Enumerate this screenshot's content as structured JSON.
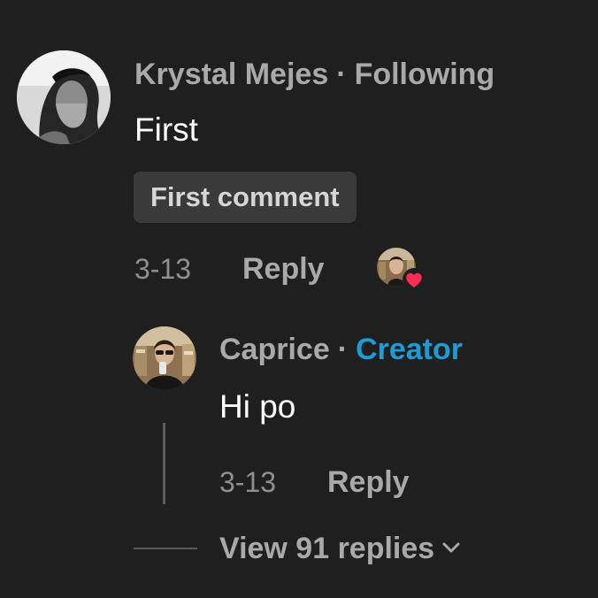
{
  "comment": {
    "author": "Krystal Mejes",
    "separator": "·",
    "relationship": "Following",
    "text": "First",
    "badge": "First comment",
    "date": "3-13",
    "reply_label": "Reply",
    "liked_by_creator": true
  },
  "reply": {
    "author": "Caprice",
    "separator": "·",
    "role": "Creator",
    "text": "Hi po",
    "date": "3-13",
    "reply_label": "Reply"
  },
  "view_replies": {
    "label": "View 91 replies"
  },
  "colors": {
    "background": "#1f1f1f",
    "muted_text": "#a9a9a9",
    "creator_accent": "#1e9bd6",
    "heart": "#fe2c55",
    "pill_bg": "#3a3a3a"
  },
  "icons": {
    "liked": "heart-icon",
    "expand": "chevron-down-icon"
  }
}
